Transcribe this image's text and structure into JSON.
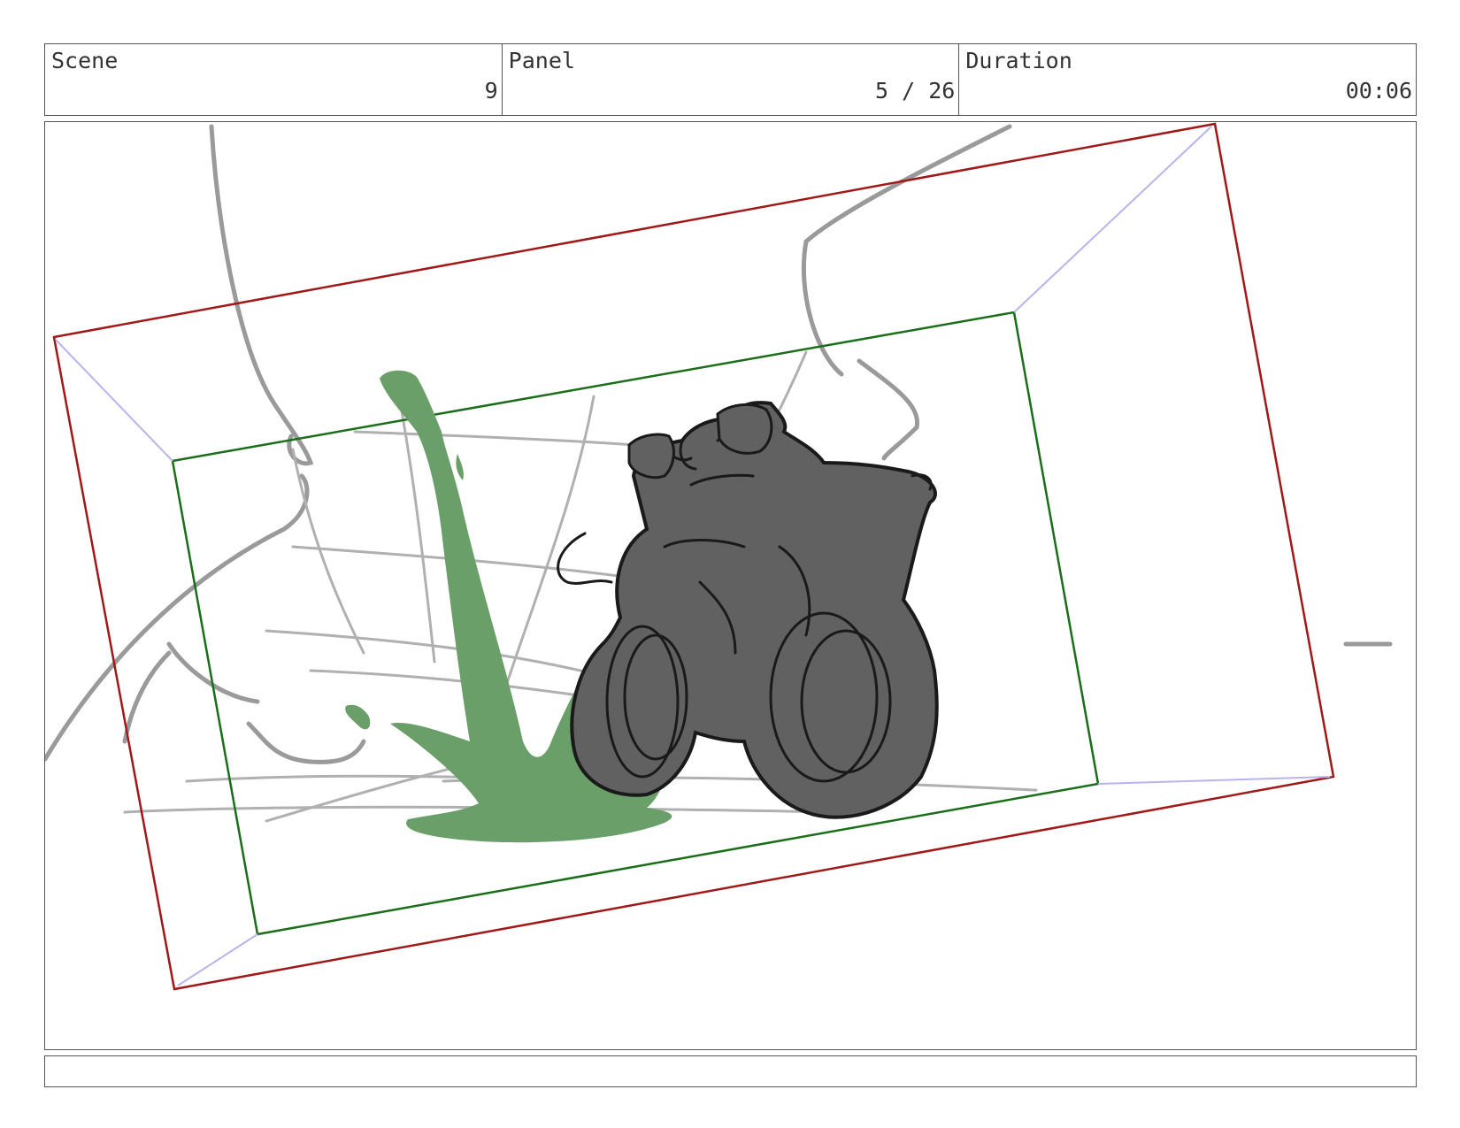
{
  "header": {
    "scene": {
      "label": "Scene",
      "value": "9"
    },
    "panel": {
      "label": "Panel",
      "value": "5 / 26"
    },
    "duration": {
      "label": "Duration",
      "value": "00:06"
    }
  },
  "caption": {
    "text": ""
  },
  "colors": {
    "border": "#555555",
    "camera_frame_outer": "#a01818",
    "camera_frame_inner": "#1a6e1a",
    "camera_guides": "#b8b4ee",
    "sketch_gray": "#999999",
    "character_fill": "#616161",
    "splash_green": "#6a9f6a"
  }
}
